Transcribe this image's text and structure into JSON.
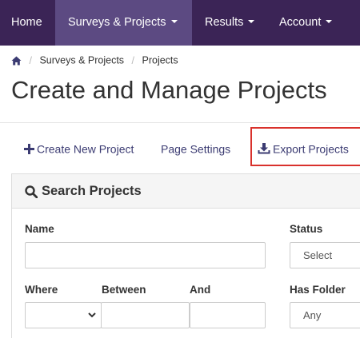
{
  "nav": {
    "items": [
      {
        "label": "Home",
        "dropdown": false,
        "active": false
      },
      {
        "label": "Surveys & Projects",
        "dropdown": true,
        "active": true
      },
      {
        "label": "Results",
        "dropdown": true,
        "active": false
      },
      {
        "label": "Account",
        "dropdown": true,
        "active": false
      }
    ],
    "bg_color": "#3b2456",
    "active_color": "#5c4a82"
  },
  "breadcrumb": {
    "icon": "home-icon",
    "items": [
      "Surveys & Projects",
      "Projects"
    ]
  },
  "page_title": "Create and Manage Projects",
  "toolbar": {
    "create_label": "Create New Project",
    "settings_label": "Page Settings",
    "export_label": "Export Projects",
    "highlight_color": "#d9312c"
  },
  "search": {
    "title": "Search Projects",
    "name_label": "Name",
    "name_value": "",
    "status_label": "Status",
    "status_value": "Select",
    "where_label": "Where",
    "where_value": "",
    "between_label": "Between",
    "between_value": "",
    "and_label": "And",
    "and_value": "",
    "folder_label": "Has Folder",
    "folder_value": "Any"
  }
}
